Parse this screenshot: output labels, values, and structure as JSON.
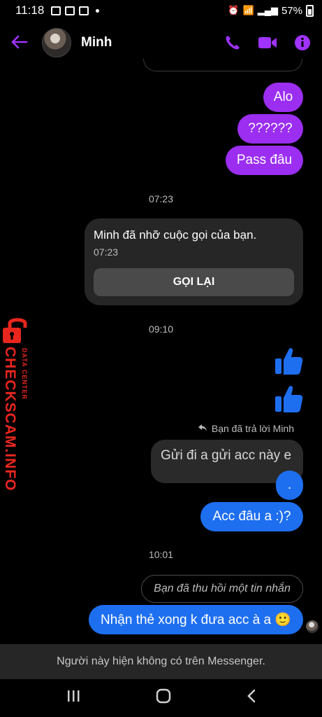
{
  "status_bar": {
    "time": "11:18",
    "battery": "57%"
  },
  "header": {
    "contact_name": "Minh",
    "accent_color": "#a033ff"
  },
  "messages": {
    "m1": "Alo",
    "m2": "??????",
    "m3": "Pass đâu",
    "ts1": "07:23",
    "missed_call": "Minh đã nhỡ cuộc gọi của bạn.",
    "missed_call_time": "07:23",
    "call_back_label": "GỌI LẠI",
    "ts2": "09:10",
    "reply_note": "Bạn đã trả lời Minh",
    "quoted": "Gửi đi a gửi acc này e",
    "m4": ".",
    "m5": "Acc đâu a  :)?",
    "ts3": "10:01",
    "recalled": "Bạn đã thu hồi một tin nhắn",
    "m6": "Nhận thẻ xong k đưa acc à a 🙂"
  },
  "watermark": {
    "big": "CHECKSCAM.INFO",
    "small": "DATA CENTER"
  },
  "footer": {
    "note": "Người này hiện không có trên Messenger."
  },
  "colors": {
    "purple_bubble": "#9b2ef0",
    "blue_bubble": "#1e6ff0",
    "watermark_red": "#e8261e"
  }
}
